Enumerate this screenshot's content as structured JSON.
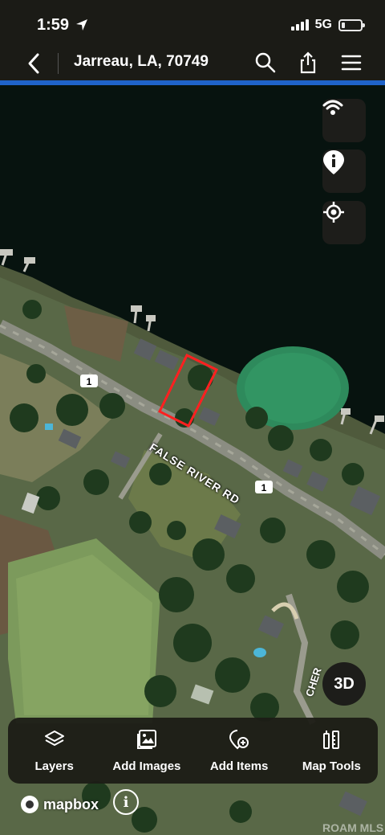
{
  "status": {
    "time": "1:59",
    "network": "5G"
  },
  "header": {
    "title": "Jarreau, LA, 70749"
  },
  "map": {
    "road_name": "FALSE RIVER RD",
    "route_shield_1": "1",
    "route_shield_2": "1",
    "road_partial": "CHER",
    "mode_button": "3D",
    "attribution_brand": "mapbox",
    "attribution_info": "i",
    "watermark": "ROAM MLS"
  },
  "toolbar": {
    "items": [
      {
        "label": "Layers",
        "icon": "layers-icon"
      },
      {
        "label": "Add Images",
        "icon": "image-icon"
      },
      {
        "label": "Add Items",
        "icon": "pin-add-icon"
      },
      {
        "label": "Map Tools",
        "icon": "tools-icon"
      }
    ]
  },
  "colors": {
    "accent": "#1f63c9",
    "parcel": "#ff2020",
    "header_bg": "#1b1b16",
    "water": "#0a140f"
  }
}
